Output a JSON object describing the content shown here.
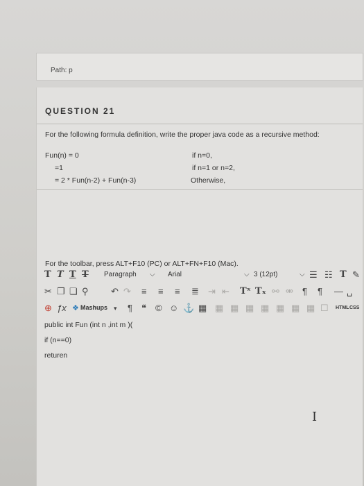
{
  "path_label": "Path: p",
  "question": {
    "title": "QUESTION 21",
    "prompt": "For the following formula definition, write the proper java code as a recursive method:",
    "formula": {
      "line1_left": "Fun(n) = 0",
      "line1_right": "if n=0,",
      "line2_left": "=1",
      "line2_right": "if n=1 or n=2,",
      "line3_left": "= 2 * Fun(n-2) + Fun(n-3)",
      "line3_right": "Otherwise,"
    },
    "toolbar_hint": "For the toolbar, press ALT+F10 (PC) or ALT+FN+F10 (Mac)."
  },
  "toolbar": {
    "paragraph_label": "Paragraph",
    "font_label": "Arial",
    "size_label": "3 (12pt)",
    "mashups_label": "Mashups",
    "html_label": "HTML",
    "css_label": "CSS"
  },
  "answer_lines": [
    "public int  Fun (int n ,int m )(",
    "if (n==0)",
    "returen"
  ]
}
